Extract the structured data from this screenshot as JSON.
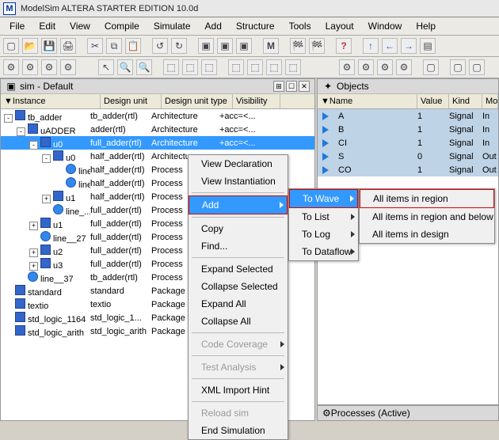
{
  "title": "ModelSim ALTERA STARTER EDITION 10.0d",
  "menus": [
    "File",
    "Edit",
    "View",
    "Compile",
    "Simulate",
    "Add",
    "Structure",
    "Tools",
    "Layout",
    "Window",
    "Help"
  ],
  "sim_panel": {
    "title": "sim - Default",
    "cols": [
      "Instance",
      "Design unit",
      "Design unit type",
      "Visibility"
    ],
    "rows": [
      {
        "d": 0,
        "exp": "-",
        "ico": "bluebox",
        "inst": "tb_adder",
        "du": "tb_adder(rtl)",
        "dut": "Architecture",
        "vis": "+acc=<..."
      },
      {
        "d": 1,
        "exp": "-",
        "ico": "bluebox",
        "inst": "uADDER",
        "du": "adder(rtl)",
        "dut": "Architecture",
        "vis": "+acc=<..."
      },
      {
        "d": 2,
        "exp": "-",
        "ico": "bluebox",
        "inst": "u0",
        "du": "full_adder(rtl)",
        "dut": "Architecture",
        "vis": "+acc=<...",
        "sel": true
      },
      {
        "d": 3,
        "exp": "-",
        "ico": "bluebox",
        "inst": "u0",
        "du": "half_adder(rtl)",
        "dut": "Architecture",
        "vis": ""
      },
      {
        "d": 4,
        "exp": "",
        "ico": "bluedot",
        "inst": "line_...",
        "du": "half_adder(rtl)",
        "dut": "Process",
        "vis": ""
      },
      {
        "d": 4,
        "exp": "",
        "ico": "bluedot",
        "inst": "line_...",
        "du": "half_adder(rtl)",
        "dut": "Process",
        "vis": ""
      },
      {
        "d": 3,
        "exp": "+",
        "ico": "bluebox",
        "inst": "u1",
        "du": "half_adder(rtl)",
        "dut": "Process",
        "vis": ""
      },
      {
        "d": 3,
        "exp": "",
        "ico": "bluedot",
        "inst": "line_...",
        "du": "full_adder(rtl)",
        "dut": "Process",
        "vis": ""
      },
      {
        "d": 2,
        "exp": "+",
        "ico": "bluebox",
        "inst": "u1",
        "du": "full_adder(rtl)",
        "dut": "Process",
        "vis": ""
      },
      {
        "d": 2,
        "exp": "",
        "ico": "bluedot",
        "inst": "line__27",
        "du": "full_adder(rtl)",
        "dut": "Process",
        "vis": ""
      },
      {
        "d": 2,
        "exp": "+",
        "ico": "bluebox",
        "inst": "u2",
        "du": "full_adder(rtl)",
        "dut": "Process",
        "vis": ""
      },
      {
        "d": 2,
        "exp": "+",
        "ico": "bluebox",
        "inst": "u3",
        "du": "full_adder(rtl)",
        "dut": "Process",
        "vis": ""
      },
      {
        "d": 1,
        "exp": "",
        "ico": "bluedot",
        "inst": "line__37",
        "du": "tb_adder(rtl)",
        "dut": "Process",
        "vis": ""
      },
      {
        "d": 0,
        "exp": "",
        "ico": "bluebox",
        "inst": "standard",
        "du": "standard",
        "dut": "Package",
        "vis": ""
      },
      {
        "d": 0,
        "exp": "",
        "ico": "bluebox",
        "inst": "textio",
        "du": "textio",
        "dut": "Package",
        "vis": ""
      },
      {
        "d": 0,
        "exp": "",
        "ico": "bluebox",
        "inst": "std_logic_1164",
        "du": "std_logic_1...",
        "dut": "Package",
        "vis": ""
      },
      {
        "d": 0,
        "exp": "",
        "ico": "bluebox",
        "inst": "std_logic_arith",
        "du": "std_logic_arith",
        "dut": "Package",
        "vis": ""
      }
    ]
  },
  "objects_panel": {
    "title": "Objects",
    "cols": [
      "Name",
      "Value",
      "Kind",
      "Mode"
    ],
    "rows": [
      {
        "name": "A",
        "val": "1",
        "kind": "Signal",
        "mode": "In"
      },
      {
        "name": "B",
        "val": "1",
        "kind": "Signal",
        "mode": "In"
      },
      {
        "name": "CI",
        "val": "1",
        "kind": "Signal",
        "mode": "In"
      },
      {
        "name": "S",
        "val": "0",
        "kind": "Signal",
        "mode": "Out"
      },
      {
        "name": "CO",
        "val": "1",
        "kind": "Signal",
        "mode": "Out"
      }
    ]
  },
  "processes_panel": "Processes (Active)",
  "context_menu": {
    "items": [
      {
        "label": "View Declaration"
      },
      {
        "label": "View Instantiation",
        "sepAfter": true
      },
      {
        "label": "Add",
        "arrow": true,
        "highlight": true,
        "red": true,
        "sepAfter": true
      },
      {
        "label": "Copy"
      },
      {
        "label": "Find...",
        "sepAfter": true
      },
      {
        "label": "Expand Selected"
      },
      {
        "label": "Collapse Selected"
      },
      {
        "label": "Expand All"
      },
      {
        "label": "Collapse All",
        "sepAfter": true
      },
      {
        "label": "Code Coverage",
        "arrow": true,
        "disabled": true,
        "sepAfter": true
      },
      {
        "label": "Test Analysis",
        "arrow": true,
        "disabled": true,
        "sepAfter": true
      },
      {
        "label": "XML Import Hint",
        "sepAfter": true
      },
      {
        "label": "Reload sim",
        "disabled": true
      },
      {
        "label": "End Simulation"
      }
    ]
  },
  "submenu_add": {
    "items": [
      {
        "label": "To Wave",
        "arrow": true,
        "highlight": true,
        "red": true
      },
      {
        "label": "To List",
        "arrow": true
      },
      {
        "label": "To Log",
        "arrow": true
      },
      {
        "label": "To Dataflow",
        "arrow": true
      }
    ]
  },
  "submenu_wave": {
    "items": [
      {
        "label": "All items in region",
        "red": true
      },
      {
        "label": "All items in region and below"
      },
      {
        "label": "All items in design"
      }
    ]
  }
}
